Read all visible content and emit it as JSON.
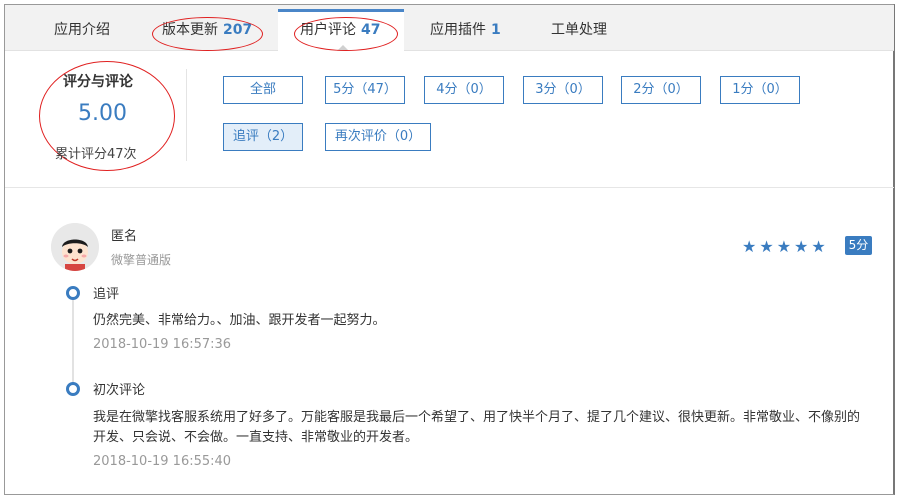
{
  "tabs": [
    {
      "label": "应用介绍",
      "count": ""
    },
    {
      "label": "版本更新",
      "count": "207"
    },
    {
      "label": "用户评论",
      "count": "47"
    },
    {
      "label": "应用插件",
      "count": "1"
    },
    {
      "label": "工单处理",
      "count": ""
    }
  ],
  "active_tab": "用户评论",
  "summary": {
    "title": "评分与评论",
    "score": "5.00",
    "count_text": "累计评分47次"
  },
  "filters": [
    {
      "label": "全部",
      "selected": false
    },
    {
      "label": "5分（47）",
      "selected": false
    },
    {
      "label": "4分（0）",
      "selected": false
    },
    {
      "label": "3分（0）",
      "selected": false
    },
    {
      "label": "2分（0）",
      "selected": false
    },
    {
      "label": "1分（0）",
      "selected": false
    },
    {
      "label": "追评（2）",
      "selected": true
    },
    {
      "label": "再次评价（0）",
      "selected": false
    }
  ],
  "review": {
    "name": "匿名",
    "edition": "微擎普通版",
    "rating": 5,
    "stars": "★★★★★",
    "badge": "5分",
    "entries": [
      {
        "label": "追评",
        "text": "仍然完美、非常给力。、加油、跟开发者一起努力。",
        "time": "2018-10-19 16:57:36"
      },
      {
        "label": "初次评论",
        "text_line1": "我是在微擎找客服系统用了好多了。万能客服是我最后一个希望了、用了快半个月了、提了几个建议、很快更新。非常敬业、不像别的",
        "text_line2": "开发、只会说、不会做。一直支持、非常敬业的开发者。",
        "time": "2018-10-19 16:55:40"
      }
    ]
  },
  "colors": {
    "accent": "#3a7cc0",
    "annotation": "#e02020",
    "muted": "#999999"
  },
  "icons": {
    "avatar": "cartoon-face-avatar",
    "star": "star-icon"
  }
}
